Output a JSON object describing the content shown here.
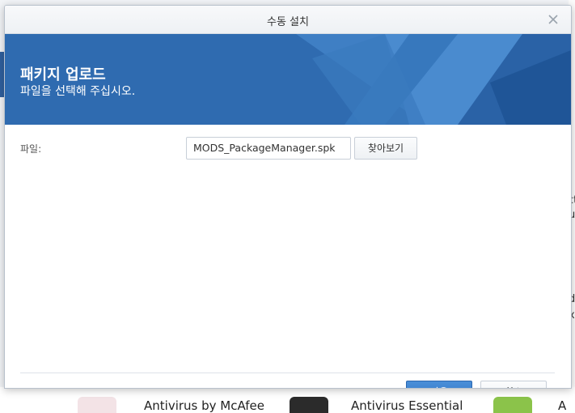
{
  "window": {
    "title": "수동 설치",
    "close_icon": "close-icon"
  },
  "banner": {
    "title": "패키지 업로드",
    "subtitle": "파일을 선택해 주십시오.",
    "color": "#2f6bb0"
  },
  "form": {
    "file_label": "파일:",
    "file_value": "MODS_PackageManager.spk",
    "browse_label": "찾아보기"
  },
  "footer": {
    "next_label": "다음",
    "cancel_label": "취소",
    "primary_color": "#3a7fcd"
  },
  "background": {
    "right_fragments": [
      "d",
      "ct",
      "u",
      "d",
      "xt"
    ],
    "bottom_items": [
      "Antivirus by McAfee",
      "Antivirus Essential",
      "A"
    ]
  }
}
